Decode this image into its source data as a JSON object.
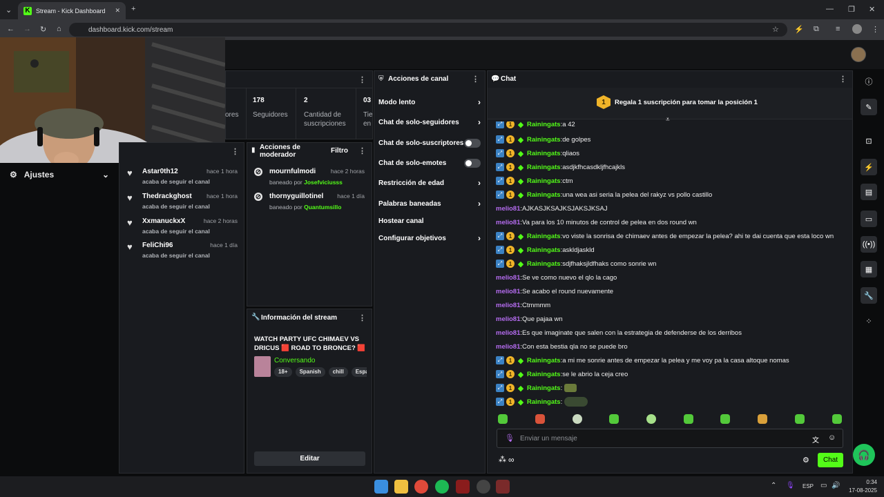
{
  "browser": {
    "tab_title": "Stream - Kick Dashboard",
    "url": "dashboard.kick.com/stream",
    "favicon": "K"
  },
  "stats": [
    {
      "value": "",
      "label": "ores"
    },
    {
      "value": "178",
      "label": "Seguidores"
    },
    {
      "value": "2",
      "label": "Cantidad de suscripciones"
    },
    {
      "value": "03",
      "label": "Tie en"
    }
  ],
  "settings": {
    "label": "Ajustes"
  },
  "followers": [
    {
      "name": "Astar0th12",
      "time": "hace 1 hora",
      "sub": "acaba de seguir el canal"
    },
    {
      "name": "Thedrackghost",
      "time": "hace 1 hora",
      "sub": "acaba de seguir el canal"
    },
    {
      "name": "XxmanuckxX",
      "time": "hace 2 horas",
      "sub": "acaba de seguir el canal"
    },
    {
      "name": "FeliChi96",
      "time": "hace 1 día",
      "sub": "acaba de seguir el canal"
    }
  ],
  "mod_actions": {
    "title": "Acciones de moderador",
    "filter": "Filtro",
    "items": [
      {
        "user": "mournfulmodi",
        "time": "hace 2 horas",
        "by_prefix": "baneado por",
        "by": "Josefviciusss"
      },
      {
        "user": "thornyguillotinel",
        "time": "hace 1 día",
        "by_prefix": "baneado por",
        "by": "Quantumsillo"
      }
    ]
  },
  "stream_info": {
    "title": "Información del stream",
    "stream_title": "WATCH PARTY UFC CHIMAEV VS DRICUS 🟥 ROAD TO BRONCE? 🟥 ...",
    "category": "Conversando",
    "tags": [
      "18+",
      "Spanish",
      "chill",
      "Espa"
    ],
    "edit_label": "Editar"
  },
  "channel_actions": {
    "title": "Acciones de canal",
    "items": [
      {
        "label": "Modo lento",
        "control": "chevron"
      },
      {
        "label": "Chat de solo-seguidores",
        "control": "chevron"
      },
      {
        "label": "Chat de solo-suscriptores",
        "control": "toggle"
      },
      {
        "label": "Chat de solo-emotes",
        "control": "toggle"
      },
      {
        "label": "Restricción de edad",
        "control": "chevron"
      },
      {
        "label": "Palabras baneadas",
        "control": "chevron"
      },
      {
        "label": "Hostear canal",
        "control": "none"
      },
      {
        "label": "Configurar objetivos",
        "control": "chevron"
      }
    ]
  },
  "chat": {
    "title": "Chat",
    "pinned_rank": "1",
    "pinned_text": "Regala 1 suscripción para tomar la posición 1",
    "input_placeholder": "Enviar un mensaje",
    "send_label": "Chat",
    "messages": [
      {
        "user": "Rainingats",
        "badges": true,
        "text": "a 42"
      },
      {
        "user": "Rainingats",
        "badges": true,
        "text": "de golpes"
      },
      {
        "user": "Rainingats",
        "badges": true,
        "text": "qliaos"
      },
      {
        "user": "Rainingats",
        "badges": true,
        "text": "asdjkfhcasdkljfhcajkls"
      },
      {
        "user": "Rainingats",
        "badges": true,
        "text": "ctm"
      },
      {
        "user": "Rainingats",
        "badges": true,
        "text": "una wea asi seria la pelea del rakyz vs pollo castillo"
      },
      {
        "user": "melio81",
        "badges": false,
        "text": "AJKASJKSAJKSJAKSJKSAJ"
      },
      {
        "user": "melio81",
        "badges": false,
        "text": "Va para los 10 minutos de control de pelea en dos round wn"
      },
      {
        "user": "Rainingats",
        "badges": true,
        "text": "vo viste la sonrisa de chimaev antes de empezar la pelea? ahi te dai cuenta que esta loco wn"
      },
      {
        "user": "Rainingats",
        "badges": true,
        "text": "askldjaskld"
      },
      {
        "user": "Rainingats",
        "badges": true,
        "text": "sdjfhaksjldfhaks como sonrie wn"
      },
      {
        "user": "melio81",
        "badges": false,
        "text": "Se ve como nuevo el qlo la cago"
      },
      {
        "user": "melio81",
        "badges": false,
        "text": "Se acabo el round nuevamente"
      },
      {
        "user": "melio81",
        "badges": false,
        "text": "Ctmmmm"
      },
      {
        "user": "melio81",
        "badges": false,
        "text": "Que pajaa wn"
      },
      {
        "user": "melio81",
        "badges": false,
        "text": "Es que imaginate que salen con la estrategia de defenderse de los derribos"
      },
      {
        "user": "melio81",
        "badges": false,
        "text": "Con esta bestia qla no se puede bro"
      },
      {
        "user": "Rainingats",
        "badges": true,
        "text": "a mi me sonrie antes de empezar la pelea y me voy pa la casa altoque nomas"
      },
      {
        "user": "Rainingats",
        "badges": true,
        "text": "se le abrio la ceja creo"
      },
      {
        "user": "Rainingats",
        "badges": true,
        "text": "",
        "emote": "small"
      },
      {
        "user": "Rainingats",
        "badges": true,
        "text": "",
        "emote": "wide"
      }
    ]
  },
  "taskbar": {
    "lang": "ESP",
    "time": "0:34",
    "date": "17-08-2025"
  },
  "colors": {
    "accent": "#53fc18",
    "melio": "#b56cf0",
    "gold": "#f0b429"
  }
}
